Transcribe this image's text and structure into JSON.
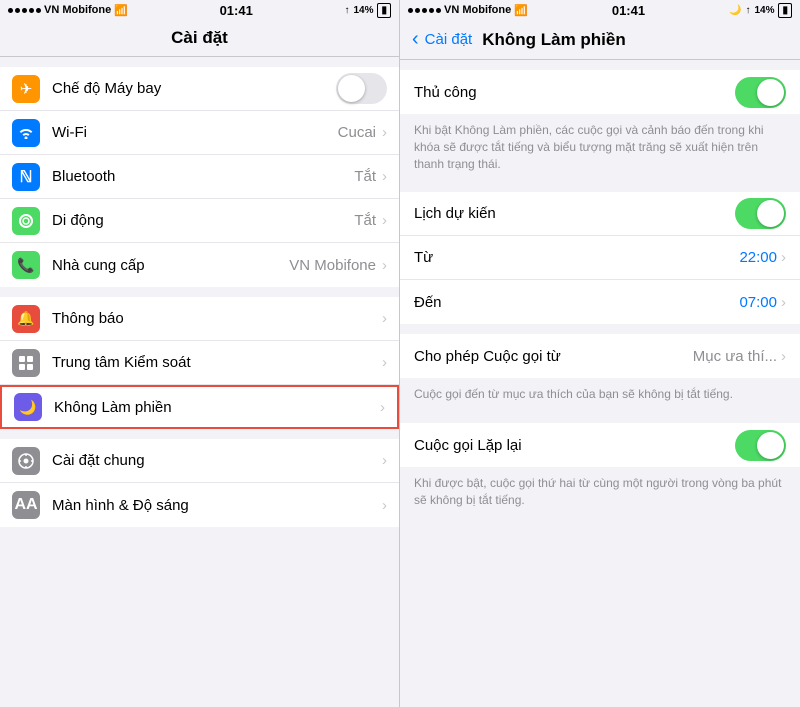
{
  "leftPanel": {
    "statusBar": {
      "carrier": "VN Mobifone",
      "time": "01:41",
      "battery": "14%"
    },
    "title": "Cài đặt",
    "groups": [
      {
        "items": [
          {
            "id": "airplane",
            "label": "Chế độ Máy bay",
            "icon": "airplane",
            "iconBg": "#ff9500",
            "iconChar": "✈",
            "valueType": "toggle",
            "toggleOn": false
          },
          {
            "id": "wifi",
            "label": "Wi-Fi",
            "icon": "wifi",
            "iconBg": "#007aff",
            "iconChar": "📶",
            "valueType": "text",
            "value": "Cucai",
            "hasChevron": true
          },
          {
            "id": "bluetooth",
            "label": "Bluetooth",
            "icon": "bluetooth",
            "iconBg": "#007aff",
            "iconChar": "B",
            "valueType": "text",
            "value": "Tắt",
            "hasChevron": true
          },
          {
            "id": "cellular",
            "label": "Di động",
            "icon": "cellular",
            "iconBg": "#4cd964",
            "iconChar": "((•))",
            "valueType": "text",
            "value": "Tắt",
            "hasChevron": true
          },
          {
            "id": "carrier",
            "label": "Nhà cung cấp",
            "icon": "carrier",
            "iconBg": "#4cd964",
            "iconChar": "📞",
            "valueType": "text",
            "value": "VN Mobifone",
            "hasChevron": true
          }
        ]
      },
      {
        "items": [
          {
            "id": "notification",
            "label": "Thông báo",
            "icon": "notification",
            "iconBg": "#e74c3c",
            "iconChar": "🔔",
            "valueType": "chevron"
          },
          {
            "id": "control",
            "label": "Trung tâm Kiểm soát",
            "icon": "control",
            "iconBg": "#8e8e93",
            "iconChar": "⊞",
            "valueType": "chevron"
          },
          {
            "id": "dnd",
            "label": "Không Làm phiền",
            "icon": "dnd",
            "iconBg": "#6c5ce7",
            "iconChar": "🌙",
            "valueType": "chevron",
            "highlighted": true
          }
        ]
      },
      {
        "items": [
          {
            "id": "general",
            "label": "Cài đặt chung",
            "icon": "general",
            "iconBg": "#8e8e93",
            "iconChar": "⚙",
            "valueType": "chevron"
          },
          {
            "id": "display",
            "label": "Màn hình & Độ sáng",
            "icon": "display",
            "iconBg": "#8e8e93",
            "iconChar": "A",
            "valueType": "chevron"
          }
        ]
      }
    ]
  },
  "rightPanel": {
    "statusBar": {
      "carrier": "VN Mobifone",
      "time": "01:41",
      "battery": "14%"
    },
    "backLabel": "Cài đặt",
    "title": "Không Làm phiền",
    "sections": [
      {
        "id": "manual",
        "rows": [
          {
            "type": "toggle-row",
            "label": "Thủ công",
            "toggleOn": true
          }
        ],
        "description": "Khi bật Không Làm phiền, các cuộc gọi và cảnh báo đến trong khi khóa sẽ được tắt tiếng và biểu tượng mặt trăng sẽ xuất hiện trên thanh trạng thái."
      },
      {
        "id": "schedule",
        "rows": [
          {
            "type": "toggle-row",
            "label": "Lịch dự kiến",
            "toggleOn": true
          },
          {
            "type": "time-row",
            "label": "Từ",
            "value": "22:00"
          },
          {
            "type": "time-row",
            "label": "Đến",
            "value": "07:00"
          }
        ]
      },
      {
        "id": "allow",
        "rows": [
          {
            "type": "link-row",
            "label": "Cho phép Cuộc gọi từ",
            "value": "Mục ưa thí..."
          }
        ],
        "description": "Cuộc gọi đến từ mục ưa thích của bạn sẽ không bị tắt tiếng."
      },
      {
        "id": "repeat",
        "rows": [
          {
            "type": "toggle-row",
            "label": "Cuộc gọi Lặp lại",
            "toggleOn": true
          }
        ],
        "description": "Khi được bật, cuộc gọi thứ hai từ cùng một người trong vòng ba phút sẽ không bị tắt tiếng."
      }
    ]
  }
}
